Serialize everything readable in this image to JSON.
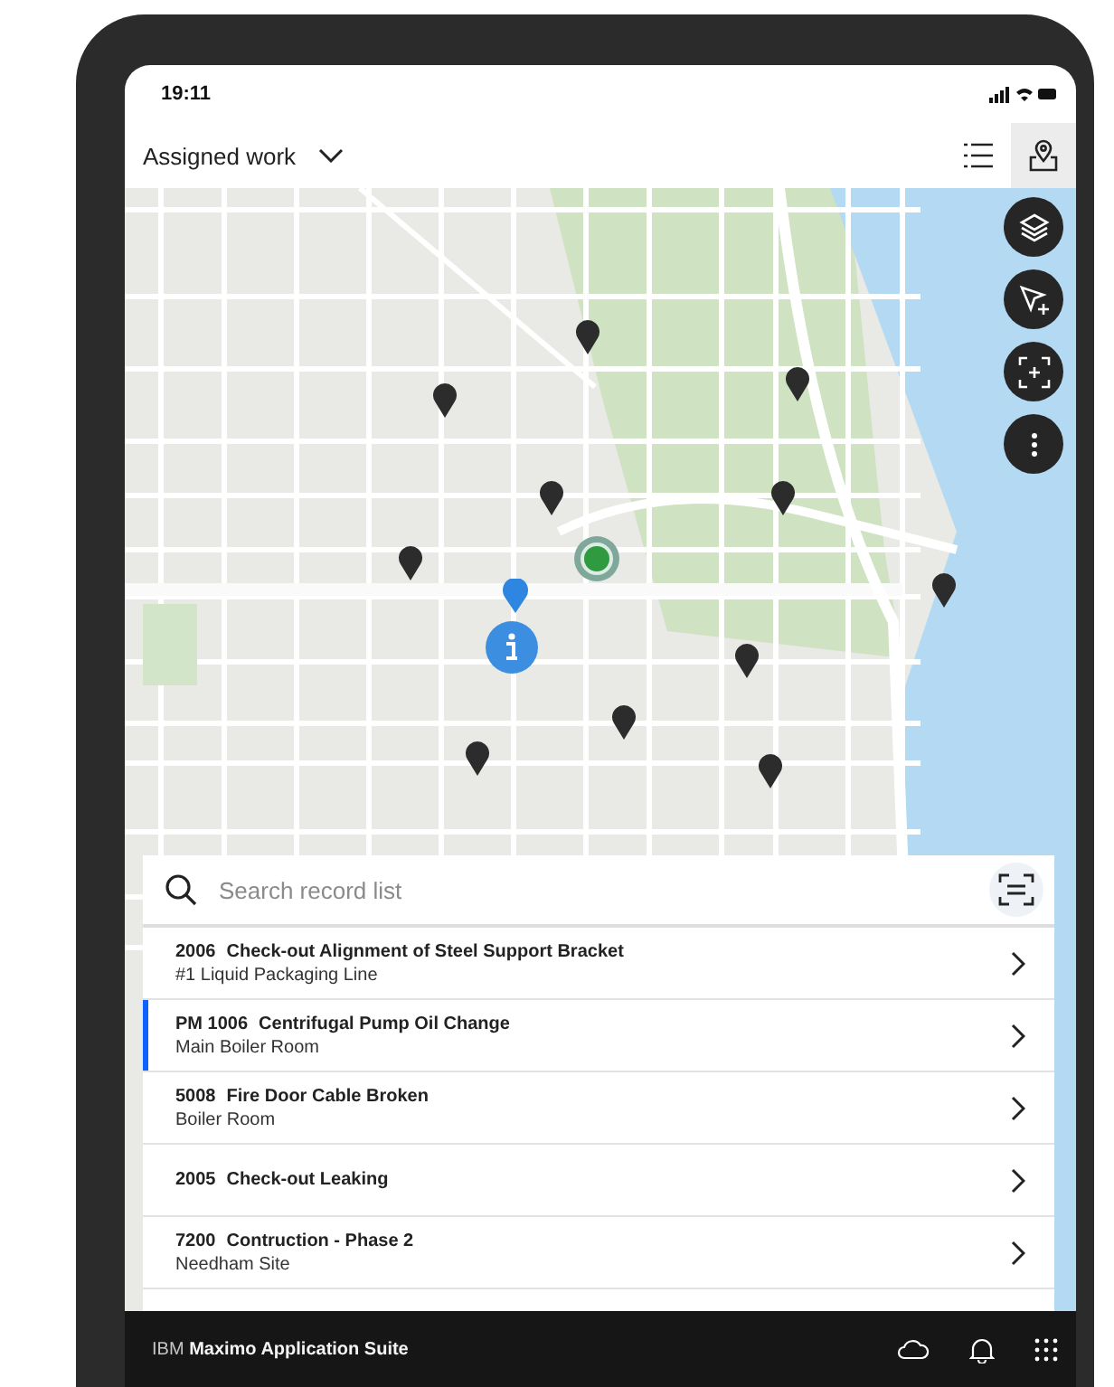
{
  "status_bar": {
    "time": "19:11"
  },
  "header": {
    "title": "Assigned work",
    "views": [
      {
        "kind": "list",
        "selected": false
      },
      {
        "kind": "map",
        "selected": true
      }
    ]
  },
  "map_tools": [
    {
      "kind": "layers"
    },
    {
      "kind": "select"
    },
    {
      "kind": "focus"
    },
    {
      "kind": "more"
    }
  ],
  "search": {
    "placeholder": "Search record list"
  },
  "records": [
    {
      "id": "2006",
      "description": "Check-out Alignment of Steel Support Bracket",
      "location": "#1 Liquid Packaging Line",
      "selected": false
    },
    {
      "id": "PM 1006",
      "description": "Centrifugal Pump Oil Change",
      "location": "Main Boiler Room",
      "selected": true
    },
    {
      "id": "5008",
      "description": "Fire Door Cable Broken",
      "location": "Boiler Room",
      "selected": false
    },
    {
      "id": "2005",
      "description": "Check-out Leaking",
      "selected": false
    },
    {
      "id": "7200",
      "description": "Contruction - Phase 2",
      "location": "Needham Site",
      "selected": false
    }
  ],
  "footer": {
    "brand": "IBM **Maximo Application Suite**"
  }
}
